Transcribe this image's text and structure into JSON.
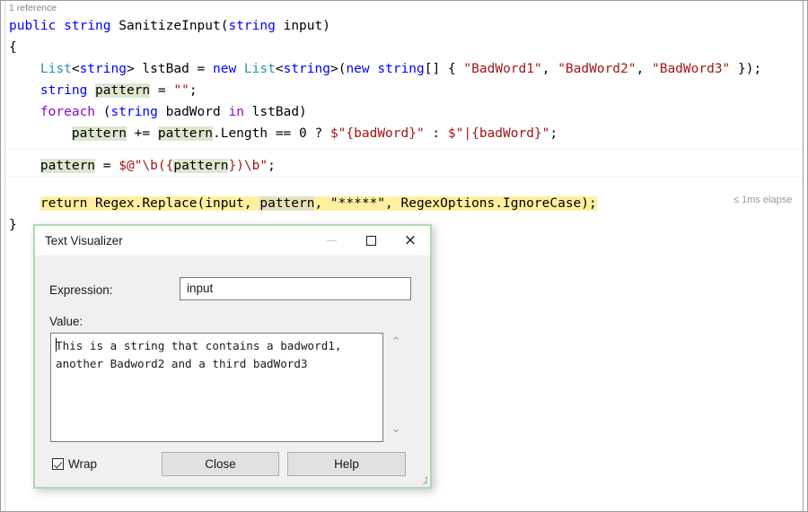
{
  "editor": {
    "reference_text": "1 reference",
    "elapsed_text": "≤ 1ms elapse",
    "lines": {
      "l1_public": "public",
      "l1_string": "string",
      "l1_name": "SanitizeInput(",
      "l1_param_type": "string",
      "l1_param": " input)",
      "l2_brace": "{",
      "l3_list": "List",
      "l3_lt": "<",
      "l3_string1": "string",
      "l3_gt": "> lstBad = ",
      "l3_new1": "new",
      "l3_list2": " List",
      "l3_lt2": "<",
      "l3_string2": "string",
      "l3_gt2": ">(",
      "l3_new2": "new",
      "l3_string3": " string",
      "l3_arr": "[] { ",
      "l3_bw1": "\"BadWord1\"",
      "l3_c1": ", ",
      "l3_bw2": "\"BadWord2\"",
      "l3_c2": ", ",
      "l3_bw3": "\"BadWord3\"",
      "l3_end": " });",
      "l4_string": "string",
      "l4_pattern": "pattern",
      "l4_eq": " = ",
      "l4_empty": "\"\"",
      "l4_semi": ";",
      "l5_foreach": "foreach",
      "l5_paren": " (",
      "l5_string": "string",
      "l5_var": " badWord ",
      "l5_in": "in",
      "l5_rest": " lstBad)",
      "l6_pattern1": "pattern",
      "l6_plus": " += ",
      "l6_pattern2": "pattern",
      "l6_len": ".Length == 0 ? ",
      "l6_s1": "$\"{badWord}\"",
      "l6_colon": " : ",
      "l6_s2": "$\"|{badWord}\"",
      "l6_semi": ";",
      "l7_pattern1": "pattern",
      "l7_eq": " = ",
      "l7_str_a": "$@\"\\b({",
      "l7_pattern2": "pattern",
      "l7_str_b": "})\\b\"",
      "l7_semi": ";",
      "l8_return": "return Regex.Replace(input, ",
      "l8_pattern": "pattern",
      "l8_rest": ", \"*****\", RegexOptions.IgnoreCase);",
      "l9_brace": "}"
    }
  },
  "dialog": {
    "title": "Text Visualizer",
    "window_buttons": {
      "minimize": "minimize-icon",
      "maximize": "maximize-icon",
      "close": "×"
    },
    "expression_label": "Expression:",
    "expression_value": "input",
    "value_label": "Value:",
    "value_text": "This is a string that contains a badword1, another Badword2 and a third badWord3",
    "scroll_up": "⌃",
    "scroll_down": "⌄",
    "wrap_label": "Wrap",
    "wrap_checked": true,
    "close_button": "Close",
    "help_button": "Help"
  },
  "colors": {
    "keyword": "#0000ff",
    "control_keyword": "#8f08c4",
    "type": "#2b91af",
    "string_literal": "#a31515",
    "current_line_highlight": "#ffef9f",
    "symbol_highlight": "#dbe8d0",
    "dialog_border": "#a8dcb4"
  }
}
